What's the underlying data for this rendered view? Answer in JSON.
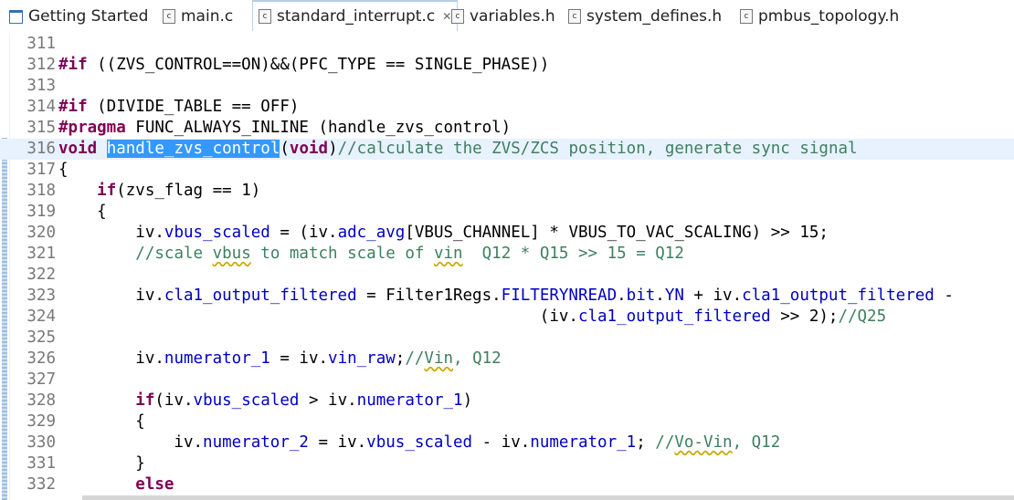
{
  "tabs": [
    {
      "label": "Getting Started",
      "icon": "window-icon",
      "active": false
    },
    {
      "label": "main.c",
      "icon": "c-file-icon",
      "active": false
    },
    {
      "label": "standard_interrupt.c",
      "icon": "c-file-icon",
      "active": true,
      "close": "✕"
    },
    {
      "label": "variables.h",
      "icon": "h-file-icon",
      "active": false
    },
    {
      "label": "system_defines.h",
      "icon": "h-file-icon",
      "active": false
    },
    {
      "label": "pmbus_topology.h",
      "icon": "h-file-icon",
      "active": false
    }
  ],
  "lines": [
    {
      "n": "311",
      "segs": []
    },
    {
      "n": "312",
      "segs": [
        [
          "kw",
          "#if"
        ],
        [
          "t",
          " ((ZVS_CONTROL==ON)&&(PFC_TYPE == SINGLE_PHASE))"
        ]
      ]
    },
    {
      "n": "313",
      "segs": []
    },
    {
      "n": "314",
      "segs": [
        [
          "kw",
          "#if"
        ],
        [
          "t",
          " (DIVIDE_TABLE == OFF)"
        ]
      ]
    },
    {
      "n": "315",
      "segs": [
        [
          "kw",
          "#pragma"
        ],
        [
          "t",
          " FUNC_ALWAYS_INLINE (handle_zvs_control)"
        ]
      ]
    },
    {
      "n": "316",
      "segs": [
        [
          "kw",
          "void"
        ],
        [
          "t",
          " "
        ],
        [
          "sel",
          "handle_zvs_control"
        ],
        [
          "t",
          "("
        ],
        [
          "kw",
          "void"
        ],
        [
          "t",
          ")"
        ],
        [
          "cm",
          "//calculate the ZVS/ZCS position, generate sync signal"
        ]
      ],
      "current": true
    },
    {
      "n": "317",
      "segs": [
        [
          "t",
          "{"
        ]
      ]
    },
    {
      "n": "318",
      "segs": [
        [
          "t",
          "    "
        ],
        [
          "kw",
          "if"
        ],
        [
          "t",
          "(zvs_flag == 1)"
        ]
      ]
    },
    {
      "n": "319",
      "segs": [
        [
          "t",
          "    {"
        ]
      ]
    },
    {
      "n": "320",
      "segs": [
        [
          "t",
          "        iv."
        ],
        [
          "fld",
          "vbus_scaled"
        ],
        [
          "t",
          " = (iv."
        ],
        [
          "fld",
          "adc_avg"
        ],
        [
          "t",
          "[VBUS_CHANNEL] * VBUS_TO_VAC_SCALING) >> 15;"
        ]
      ]
    },
    {
      "n": "321",
      "segs": [
        [
          "t",
          "        "
        ],
        [
          "cm",
          "//scale "
        ],
        [
          "cmw",
          "vbus"
        ],
        [
          "cm",
          " to match scale of "
        ],
        [
          "cmw",
          "vin"
        ],
        [
          "cm",
          "  Q12 * Q15 >> 15 = Q12"
        ]
      ]
    },
    {
      "n": "322",
      "segs": []
    },
    {
      "n": "323",
      "segs": [
        [
          "t",
          "        iv."
        ],
        [
          "fld",
          "cla1_output_filtered"
        ],
        [
          "t",
          " = Filter1Regs."
        ],
        [
          "fld",
          "FILTERYNREAD"
        ],
        [
          "t",
          "."
        ],
        [
          "fld",
          "bit"
        ],
        [
          "t",
          "."
        ],
        [
          "fld",
          "YN"
        ],
        [
          "t",
          " + iv."
        ],
        [
          "fld",
          "cla1_output_filtered"
        ],
        [
          "t",
          " -"
        ]
      ]
    },
    {
      "n": "324",
      "segs": [
        [
          "t",
          "                                                  (iv."
        ],
        [
          "fld",
          "cla1_output_filtered"
        ],
        [
          "t",
          " >> 2);"
        ],
        [
          "cm",
          "//Q25"
        ]
      ]
    },
    {
      "n": "325",
      "segs": []
    },
    {
      "n": "326",
      "segs": [
        [
          "t",
          "        iv."
        ],
        [
          "fld",
          "numerator_1"
        ],
        [
          "t",
          " = iv."
        ],
        [
          "fld",
          "vin_raw"
        ],
        [
          "t",
          ";"
        ],
        [
          "cm",
          "//"
        ],
        [
          "cmw",
          "Vin"
        ],
        [
          "cm",
          ", Q12"
        ]
      ]
    },
    {
      "n": "327",
      "segs": []
    },
    {
      "n": "328",
      "segs": [
        [
          "t",
          "        "
        ],
        [
          "kw",
          "if"
        ],
        [
          "t",
          "(iv."
        ],
        [
          "fld",
          "vbus_scaled"
        ],
        [
          "t",
          " > iv."
        ],
        [
          "fld",
          "numerator_1"
        ],
        [
          "t",
          ")"
        ]
      ]
    },
    {
      "n": "329",
      "segs": [
        [
          "t",
          "        {"
        ]
      ]
    },
    {
      "n": "330",
      "segs": [
        [
          "t",
          "            iv."
        ],
        [
          "fld",
          "numerator_2"
        ],
        [
          "t",
          " = iv."
        ],
        [
          "fld",
          "vbus_scaled"
        ],
        [
          "t",
          " - iv."
        ],
        [
          "fld",
          "numerator_1"
        ],
        [
          "t",
          "; "
        ],
        [
          "cm",
          "//"
        ],
        [
          "cmw",
          "Vo-Vin"
        ],
        [
          "cm",
          ", Q12"
        ]
      ]
    },
    {
      "n": "331",
      "segs": [
        [
          "t",
          "        }"
        ]
      ]
    },
    {
      "n": "332",
      "segs": [
        [
          "t",
          "        "
        ],
        [
          "kw",
          "else"
        ]
      ]
    }
  ]
}
